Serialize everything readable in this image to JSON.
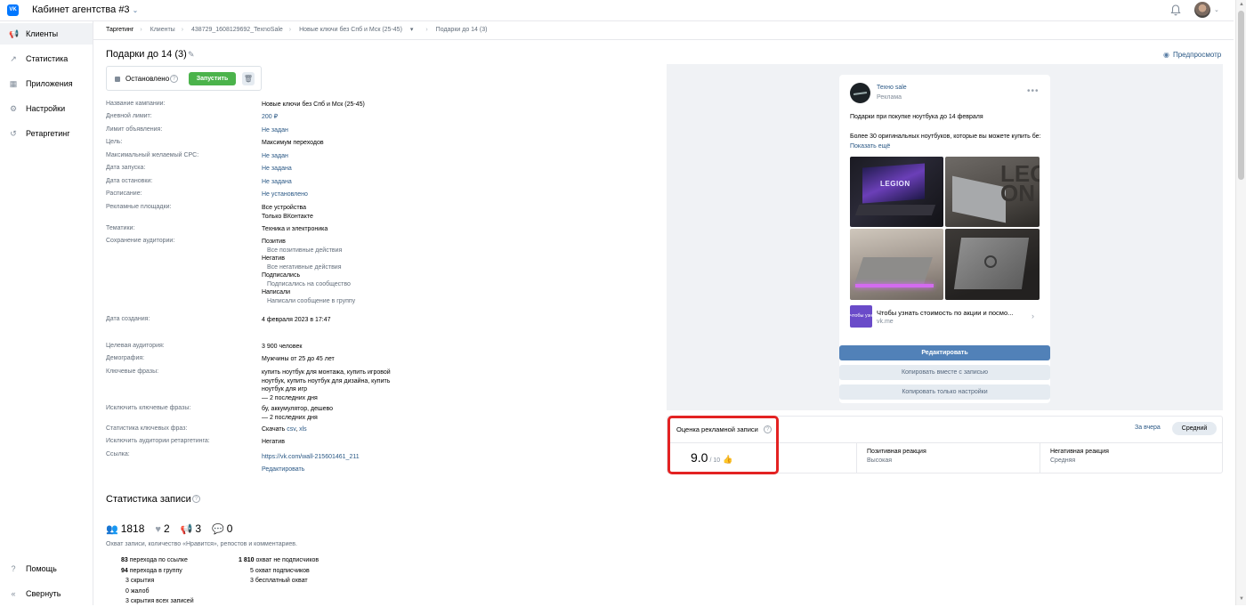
{
  "header": {
    "vk_logo": "VK",
    "cabinet_title": "Кабинет агентства #3",
    "chevron": "⌄"
  },
  "sidebar": {
    "items": [
      {
        "label": "Клиенты",
        "icon": "megaphone-icon",
        "glyph": "📢"
      },
      {
        "label": "Статистика",
        "icon": "chart-icon",
        "glyph": "↗"
      },
      {
        "label": "Приложения",
        "icon": "apps-icon",
        "glyph": "▦"
      },
      {
        "label": "Настройки",
        "icon": "gear-icon",
        "glyph": "⚙"
      },
      {
        "label": "Ретаргетинг",
        "icon": "retarget-icon",
        "glyph": "↺"
      }
    ],
    "help": "Помощь",
    "collapse": "Свернуть"
  },
  "breadcrumbs": {
    "items": [
      "Таргетинг",
      "Клиенты",
      "438729_1608129692_TexnoSale",
      "Новые ключи без Спб и Мск (25-45)",
      "Подарки до 14 (3)"
    ],
    "dropdown": "▾"
  },
  "page": {
    "title": "Подарки до 14 (3)",
    "preview": "Предпросмотр"
  },
  "status": {
    "text": "Остановлено",
    "help": "?",
    "run_button": "Запустить",
    "trash": "🗑"
  },
  "props": {
    "campaign_name": {
      "label": "Название кампании:",
      "value": "Новые ключи без Спб и Мск (25-45)"
    },
    "daily_limit": {
      "label": "Дневной лимит:",
      "value": "200 ₽"
    },
    "ad_limit": {
      "label": "Лимит объявления:",
      "value": "Не задан"
    },
    "goal": {
      "label": "Цель:",
      "value": "Максимум переходов"
    },
    "max_cpc": {
      "label": "Максимальный желаемый CPC:",
      "value": "Не задан"
    },
    "start_date": {
      "label": "Дата запуска:",
      "value": "Не задана"
    },
    "stop_date": {
      "label": "Дата остановки:",
      "value": "Не задана"
    },
    "schedule": {
      "label": "Расписание:",
      "value": "Не установлено"
    },
    "placements": {
      "label": "Рекламные площадки:",
      "line1": "Все устройства",
      "line2": "Только ВКонтакте"
    },
    "topics": {
      "label": "Тематики:",
      "value": "Техника и электроника"
    },
    "audience_saving": {
      "label": "Сохранение аудитории:",
      "items": [
        {
          "title": "Позитив",
          "sub": "Все позитивные действия"
        },
        {
          "title": "Негатив",
          "sub": "Все негативные действия"
        },
        {
          "title": "Подписались",
          "sub": "Подписались на сообщество"
        },
        {
          "title": "Написали",
          "sub": "Написали сообщение в группу"
        }
      ]
    },
    "created": {
      "label": "Дата создания:",
      "value": "4 февраля 2023 в 17:47"
    },
    "target_audience": {
      "label": "Целевая аудитория:",
      "value": "3 900 человек"
    },
    "demography": {
      "label": "Демография:",
      "value": "Мужчины от 25 до 45 лет"
    },
    "keywords": {
      "label": "Ключевые фразы:",
      "line1": "купить ноутбук для монтажа, купить игровой",
      "line2": "ноутбук, купить ноутбук для дизайна, купить",
      "line3": "ноутбук для игр",
      "line4": "— 2 последних дня"
    },
    "exclude_keywords": {
      "label": "Исключить ключевые фразы:",
      "line1": "бу, аккумулятор, дешево",
      "line2": "— 2 последних дня"
    },
    "keyword_stats": {
      "label": "Статистика ключевых фраз:",
      "prefix": "Скачать ",
      "csv": "csv",
      "comma": ", ",
      "xls": "xls"
    },
    "exclude_retarget": {
      "label": "Исключить аудитории ретаргетинга:",
      "value": "Негатив"
    },
    "link": {
      "label": "Ссылка:",
      "value": "https://vk.com/wall-215601461_211",
      "edit": "Редактировать"
    }
  },
  "stats": {
    "title": "Статистика записи",
    "counters": [
      {
        "icon": "reach-icon",
        "glyph": "👥",
        "value": "1818"
      },
      {
        "icon": "like-icon",
        "glyph": "♥",
        "value": "2"
      },
      {
        "icon": "repost-icon",
        "glyph": "📢",
        "value": "3"
      },
      {
        "icon": "comment-icon",
        "glyph": "💬",
        "value": "0"
      }
    ],
    "description": "Охват записи, количество «Нравится», репостов и комментариев.",
    "left": [
      {
        "num": "83",
        "text": " перехода по ссылке"
      },
      {
        "num": "94",
        "text": " перехода в группу"
      },
      {
        "num": "",
        "text": "3 скрытия"
      },
      {
        "num": "",
        "text": "0 жалоб"
      },
      {
        "num": "",
        "text": "3 скрытия всех записей"
      }
    ],
    "right": [
      {
        "num": "1 810",
        "text": " охват не подписчиков"
      },
      {
        "num": "",
        "text": "5 охват подписчиков"
      },
      {
        "num": "",
        "text": "3 бесплатный охват"
      }
    ]
  },
  "post": {
    "author": "Техно sale",
    "ad_label": "Реклама",
    "dots": "•••",
    "text1": "Подарки при покупке ноутбука до 14 февраля",
    "text2": "Более 30 оригинальных ноутбуков, которые вы можете купить б",
    "text_ellipsis": "е: ",
    "show_more": "Показать ещё",
    "image_text": "LEGION",
    "image_text2": "LEG\nON",
    "link_thumb": "чтобы узнать",
    "link_title": "Чтобы узнать стоимость по акции и посмо...",
    "link_domain": "vk.me"
  },
  "actions": {
    "edit": "Редактировать",
    "copy_with_post": "Копировать вместе с записью",
    "copy_settings": "Копировать только настройки"
  },
  "score": {
    "title": "Оценка рекламной записи",
    "period": "За вчера",
    "level_pill": "Средний",
    "value": "9.0",
    "of": "/ 10",
    "emoji": "👍",
    "positive_label": "Позитивная реакция",
    "positive_value": "Высокая",
    "negative_label": "Негативная реакция",
    "negative_value": "Средняя"
  },
  "colors": {
    "accent": "#2a5885",
    "primary_button": "#5181b8",
    "run_button": "#4bb34b",
    "highlight_frame": "#e32222"
  }
}
